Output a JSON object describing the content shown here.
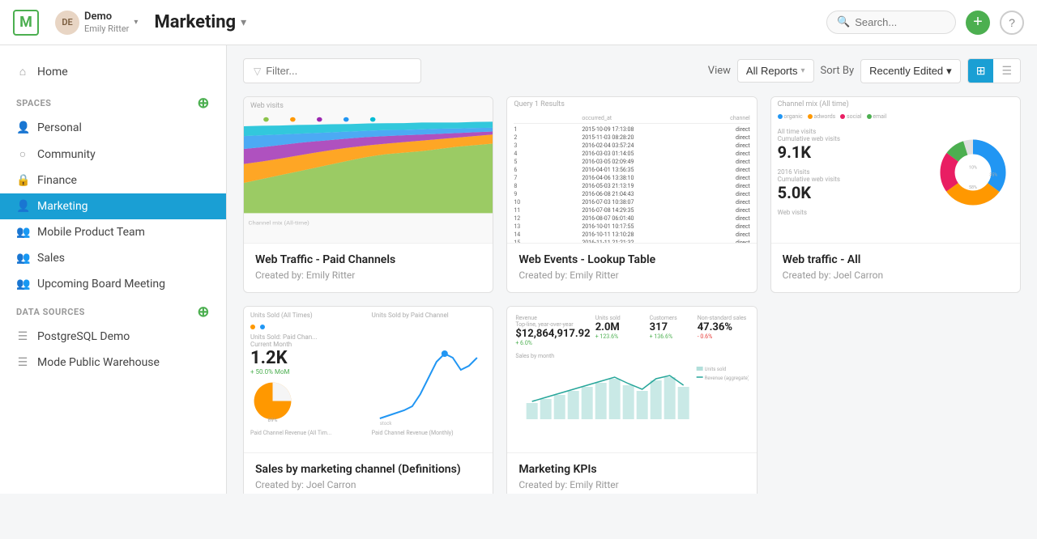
{
  "app": {
    "logo": "M",
    "title": "Marketing"
  },
  "user": {
    "initials": "DE",
    "name": "Demo",
    "email": "Emily Ritter",
    "chevron": "▾"
  },
  "search": {
    "placeholder": "Search..."
  },
  "nav": {
    "home_label": "Home",
    "spaces_label": "SPACES",
    "data_sources_label": "DATA SOURCES",
    "spaces": [
      {
        "label": "Personal",
        "icon": "person"
      },
      {
        "label": "Community",
        "icon": "globe"
      },
      {
        "label": "Finance",
        "icon": "lock"
      },
      {
        "label": "Marketing",
        "icon": "person",
        "active": true
      },
      {
        "label": "Mobile Product Team",
        "icon": "persons"
      },
      {
        "label": "Sales",
        "icon": "persons"
      },
      {
        "label": "Upcoming Board Meeting",
        "icon": "persons"
      }
    ],
    "data_sources": [
      {
        "label": "PostgreSQL Demo",
        "icon": "db"
      },
      {
        "label": "Mode Public Warehouse",
        "icon": "db"
      }
    ]
  },
  "toolbar": {
    "filter_placeholder": "Filter...",
    "view_label": "View",
    "view_value": "All Reports",
    "sort_label": "Sort By",
    "sort_value": "Recently Edited"
  },
  "reports": [
    {
      "title": "Web Traffic - Paid Channels",
      "creator": "Created by: Emily Ritter",
      "type": "area_chart"
    },
    {
      "title": "Web Events - Lookup Table",
      "creator": "Created by: Emily Ritter",
      "type": "table"
    },
    {
      "title": "Web traffic - All",
      "creator": "Created by: Joel Carron",
      "type": "donut"
    },
    {
      "title": "Sales by marketing channel (Definitions)",
      "creator": "Created by: Joel Carron",
      "type": "paid"
    },
    {
      "title": "Marketing KPIs",
      "creator": "Created by: Emily Ritter",
      "type": "kpi"
    }
  ]
}
